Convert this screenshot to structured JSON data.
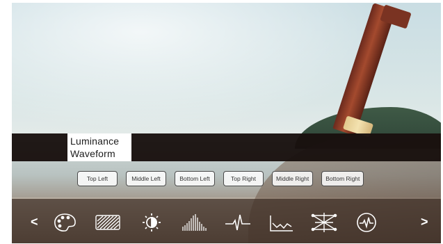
{
  "panel": {
    "title_line1": "Luminance",
    "title_line2": "Waveform"
  },
  "positions": [
    {
      "label": "Top Left"
    },
    {
      "label": "Middle Left"
    },
    {
      "label": "Bottom Left"
    },
    {
      "label": "Top Right"
    },
    {
      "label": "Middle Right"
    },
    {
      "label": "Bottom Right"
    }
  ],
  "toolbar": {
    "prev_label": "<",
    "next_label": ">",
    "tools": [
      "palette-icon",
      "zebra-stripes-icon",
      "brightness-icon",
      "histogram-icon",
      "waveform-icon",
      "luma-curve-icon",
      "vectorscope-icon",
      "scope-circle-icon"
    ]
  },
  "colors": {
    "title_bar": "#18100e",
    "toolbar": "#3c2c24",
    "icon": "#ffffff"
  }
}
